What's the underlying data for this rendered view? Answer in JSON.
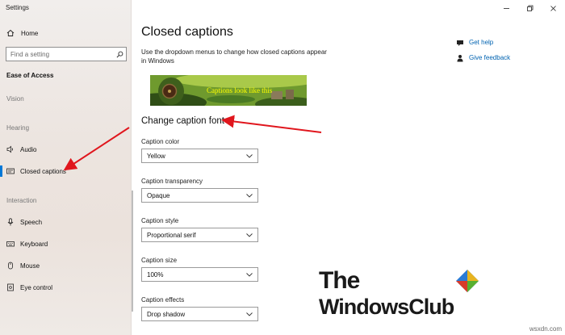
{
  "window": {
    "title": "Settings",
    "controls": [
      "minimize-icon",
      "restore-icon",
      "close-icon"
    ]
  },
  "sidebar": {
    "home_label": "Home",
    "search_placeholder": "Find a setting",
    "section_title": "Ease of Access",
    "groups": {
      "vision": "Vision",
      "hearing": "Hearing",
      "interaction": "Interaction"
    },
    "items": {
      "audio": "Audio",
      "closed_captions": "Closed captions",
      "speech": "Speech",
      "keyboard": "Keyboard",
      "mouse": "Mouse",
      "eye_control": "Eye control"
    },
    "selected": "closed_captions"
  },
  "main": {
    "title": "Closed captions",
    "description": "Use the dropdown menus to change how closed captions appear in Windows",
    "preview_text": "Captions look like this",
    "related": {
      "get_help": "Get help",
      "give_feedback": "Give feedback"
    },
    "section_heading": "Change caption font",
    "fields": [
      {
        "label": "Caption color",
        "value": "Yellow"
      },
      {
        "label": "Caption transparency",
        "value": "Opaque"
      },
      {
        "label": "Caption style",
        "value": "Proportional serif"
      },
      {
        "label": "Caption size",
        "value": "100%"
      },
      {
        "label": "Caption effects",
        "value": "Drop shadow"
      }
    ]
  },
  "overlay": {
    "watermark_line1": "The",
    "watermark_line2": "WindowsClub",
    "site": "wsxdn.com",
    "arrow_color": "#e0161d",
    "accent": "#0078d7",
    "link_color": "#0063b1"
  }
}
